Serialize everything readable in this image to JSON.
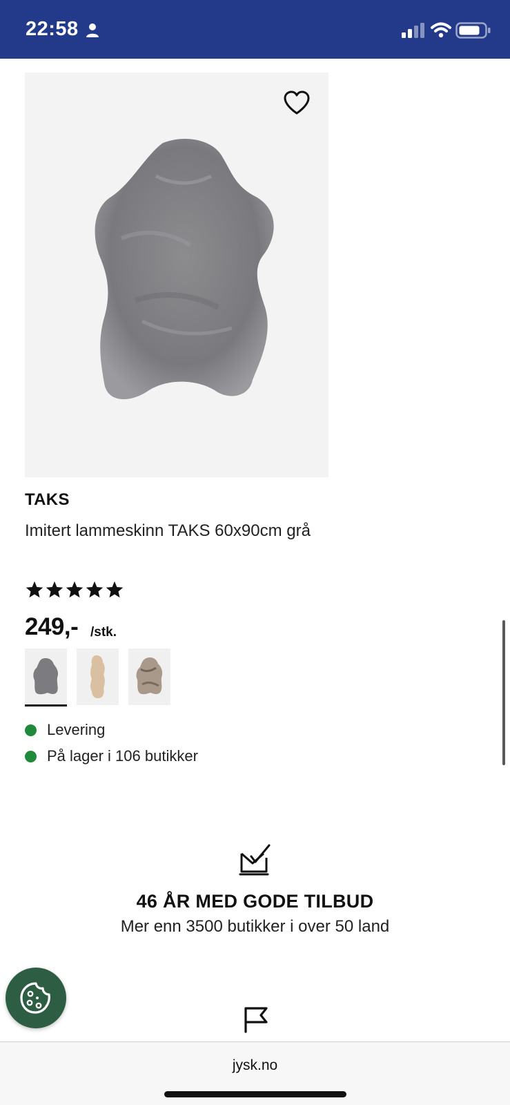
{
  "status_bar": {
    "time": "22:58",
    "background": "#233a8a"
  },
  "product": {
    "brand": "TAKS",
    "name": "Imitert lammeskinn TAKS 60x90cm grå",
    "rating_stars": 5,
    "price": "249,-",
    "unit": "/stk.",
    "variants": [
      {
        "color": "grey",
        "selected": true
      },
      {
        "color": "beige",
        "selected": false
      },
      {
        "color": "brown",
        "selected": false
      }
    ],
    "availability": [
      {
        "label": "Levering",
        "status_color": "#1f8a3c"
      },
      {
        "label": "På lager i 106 butikker",
        "status_color": "#1f8a3c"
      }
    ]
  },
  "promo": {
    "title": "46 ÅR MED GODE TILBUD",
    "subtitle": "Mer enn 3500 butikker i over 50 land"
  },
  "browser": {
    "url": "jysk.no"
  },
  "colors": {
    "accent_blue": "#233a8a",
    "stock_green": "#1f8a3c",
    "cookie_green": "#2d5e43"
  }
}
